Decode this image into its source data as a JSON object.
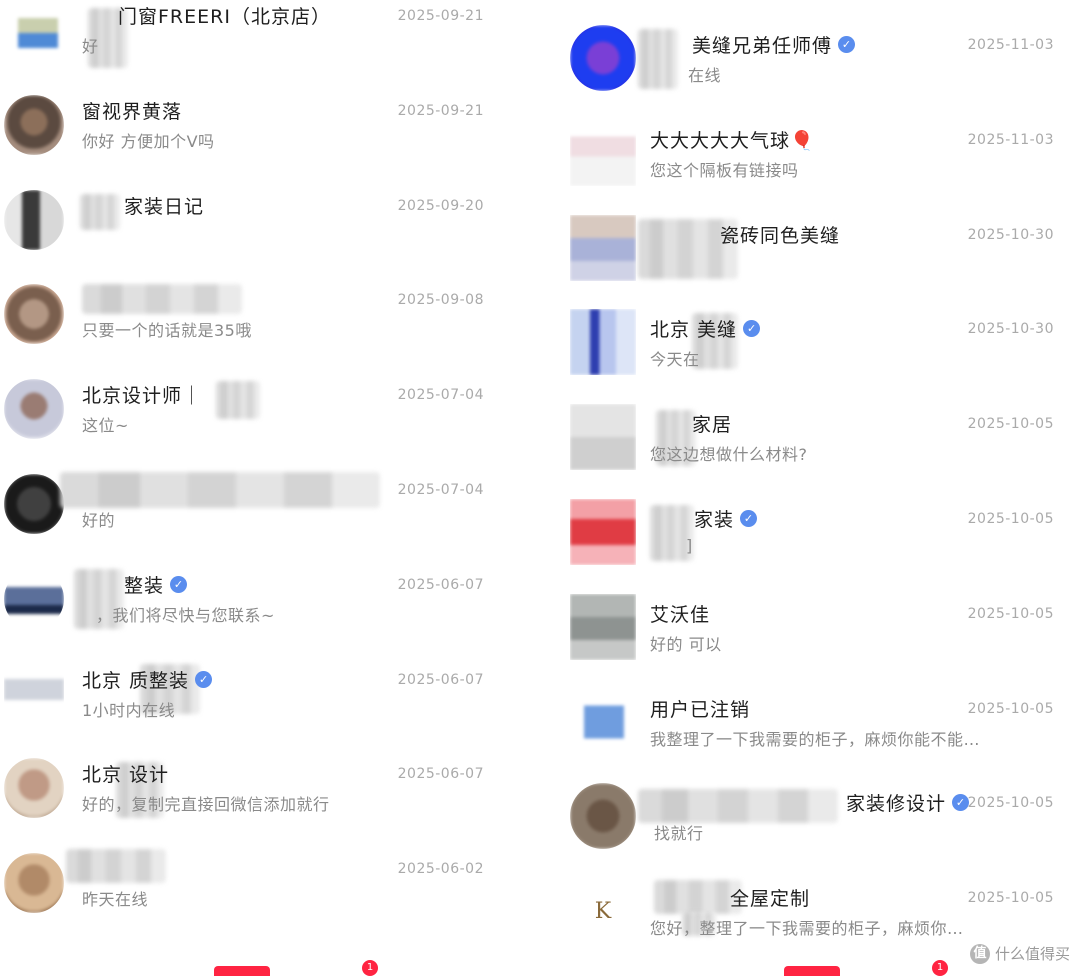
{
  "left_conversations": [
    {
      "name": "门窗FREERI（北京店）",
      "preview": "好",
      "date": "2025-09-21",
      "verified": false
    },
    {
      "name": "窗视界黄落",
      "preview": "你好 方便加个V吗",
      "date": "2025-09-21",
      "verified": false
    },
    {
      "name": "家装日记",
      "preview": "",
      "date": "2025-09-20",
      "verified": false
    },
    {
      "name": "",
      "preview": "只要一个的话就是35哦",
      "date": "2025-09-08",
      "verified": false
    },
    {
      "name": "北京设计师｜",
      "preview": "这位~",
      "date": "2025-07-04",
      "verified": false
    },
    {
      "name": "",
      "preview": "好的",
      "date": "2025-07-04",
      "verified": false
    },
    {
      "name": "整装",
      "preview": "，我们将尽快与您联系~",
      "date": "2025-06-07",
      "verified": true
    },
    {
      "name": "北京 质整装",
      "preview": "1小时内在线",
      "date": "2025-06-07",
      "verified": true
    },
    {
      "name": "北京 设计",
      "preview": "好的，复制完直接回微信添加就行",
      "date": "2025-06-07",
      "verified": false
    },
    {
      "name": "",
      "preview": "昨天在线",
      "date": "2025-06-02",
      "verified": false
    }
  ],
  "right_conversations": [
    {
      "name": "美缝兄弟任师傅",
      "preview": "在线",
      "date": "2025-11-03",
      "verified": true
    },
    {
      "name": "大大大大大气球🎈",
      "preview": "您这个隔板有链接吗",
      "date": "2025-11-03",
      "verified": false
    },
    {
      "name": "瓷砖同色美缝",
      "preview": "",
      "date": "2025-10-30",
      "verified": false
    },
    {
      "name": "北京 美缝",
      "preview": "今天在",
      "date": "2025-10-30",
      "verified": true
    },
    {
      "name": "家居",
      "preview": "您这边想做什么材料?",
      "date": "2025-10-05",
      "verified": false
    },
    {
      "name": "家装",
      "preview": "]",
      "date": "2025-10-05",
      "verified": true
    },
    {
      "name": "艾沃佳",
      "preview": "好的 可以",
      "date": "2025-10-05",
      "verified": false
    },
    {
      "name": "用户已注销",
      "preview": "我整理了一下我需要的柜子，麻烦你能不能…",
      "date": "2025-10-05",
      "verified": false
    },
    {
      "name": "家装修设计",
      "preview": "找就行",
      "date": "2025-10-05",
      "verified": true
    },
    {
      "name": "全屋定制",
      "preview": "您好，整理了一下我需要的柜子，麻烦你…",
      "date": "2025-10-05",
      "verified": false
    }
  ],
  "badges": {
    "count": "1"
  },
  "watermark": {
    "text": "什么值得买",
    "icon": "值"
  },
  "colors": {
    "accent": "#ff2442",
    "verified": "#5a8dee"
  }
}
